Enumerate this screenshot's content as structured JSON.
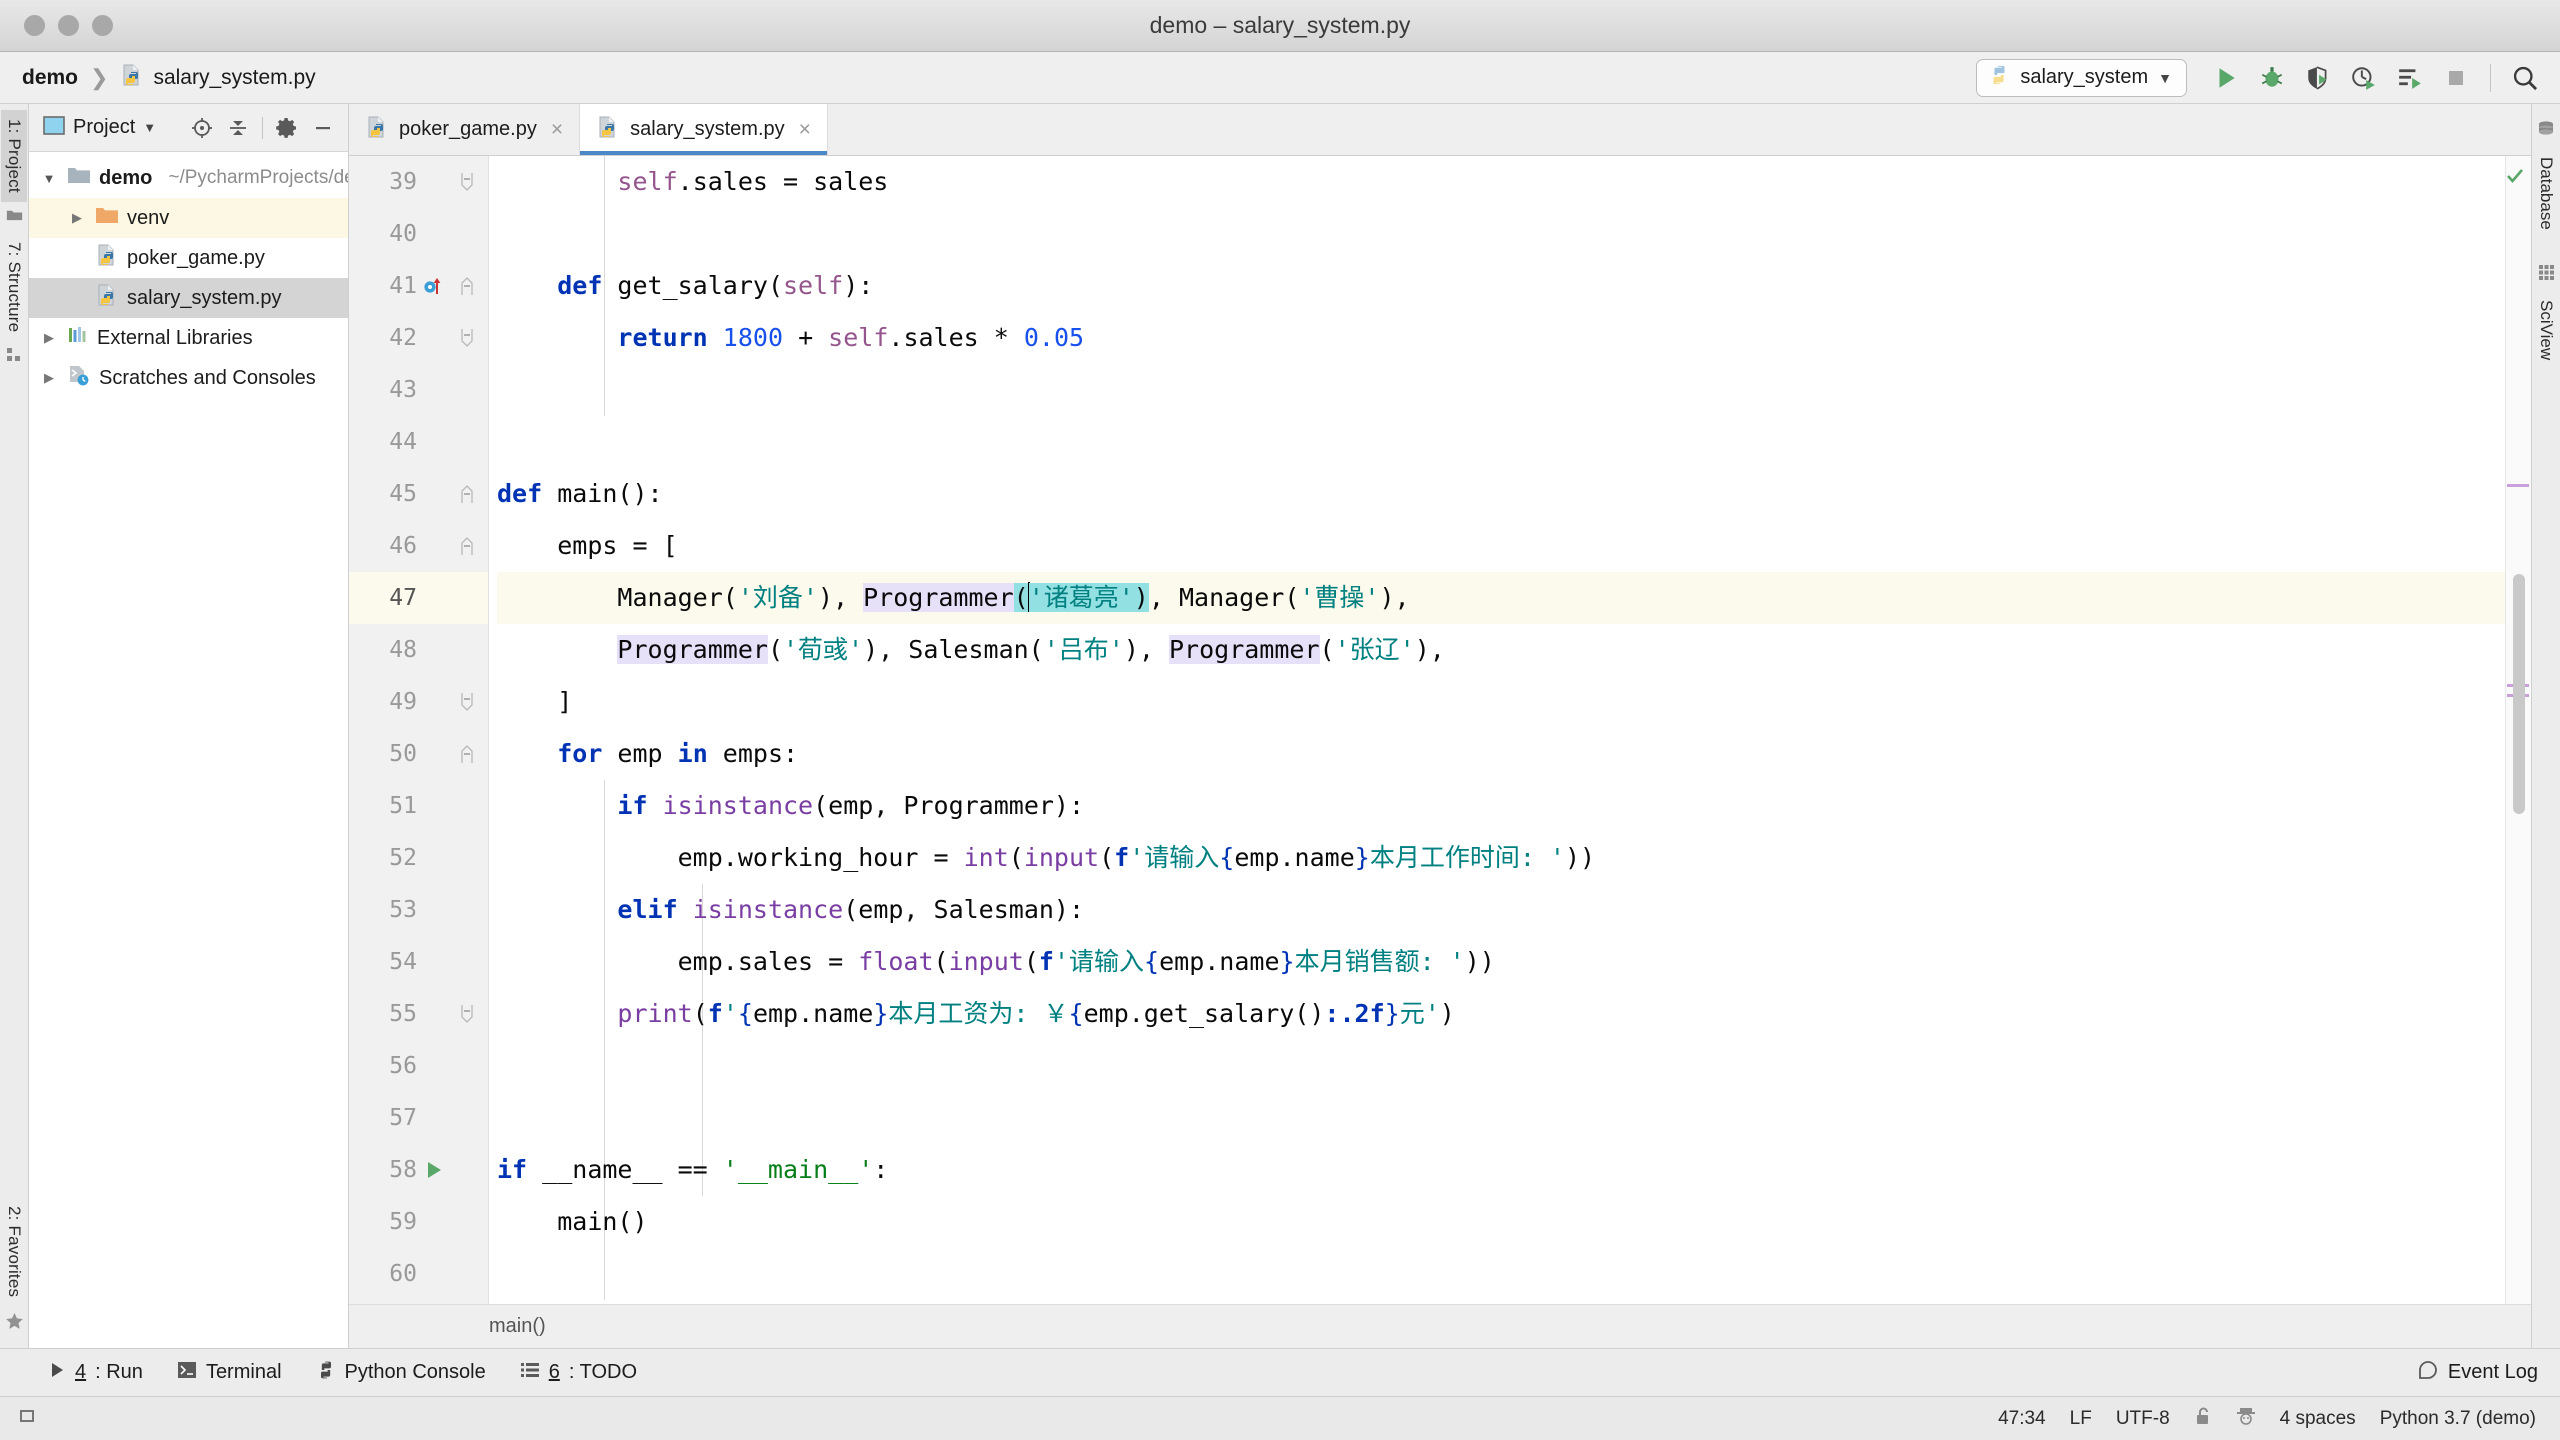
{
  "window": {
    "title": "demo – salary_system.py",
    "traffic_lights": [
      "close-button",
      "minimize-button",
      "zoom-button"
    ]
  },
  "navbar": {
    "breadcrumb": {
      "project": "demo",
      "separator": "❯",
      "file": "salary_system.py"
    },
    "run_config": {
      "label": "salary_system",
      "chevron": "▼"
    },
    "buttons": [
      {
        "name": "run-button",
        "label": "Run"
      },
      {
        "name": "debug-button",
        "label": "Debug"
      },
      {
        "name": "run-with-coverage-button",
        "label": "Run with Coverage"
      },
      {
        "name": "profile-button",
        "label": "Profile"
      },
      {
        "name": "run-tests-button",
        "label": "Run Tests"
      },
      {
        "name": "stop-button",
        "label": "Stop"
      },
      {
        "name": "search-everywhere-button",
        "label": "Search Everywhere"
      }
    ]
  },
  "left_rail": {
    "tabs": [
      {
        "name": "tool-tab-project",
        "label": "1: Project",
        "selected": true
      },
      {
        "name": "tool-tab-structure",
        "label": "7: Structure",
        "selected": false
      },
      {
        "name": "tool-tab-favorites",
        "label": "2: Favorites",
        "selected": false
      }
    ]
  },
  "right_rail": {
    "tabs": [
      {
        "name": "tool-tab-database",
        "label": "Database"
      },
      {
        "name": "tool-tab-sciview",
        "label": "SciView"
      }
    ]
  },
  "project_panel": {
    "title": "Project",
    "title_chevron": "▼",
    "actions": [
      {
        "name": "select-opened-file-button",
        "label": "Select Opened File"
      },
      {
        "name": "collapse-all-button",
        "label": "Collapse All"
      },
      {
        "name": "settings-gear-button",
        "label": "Settings"
      },
      {
        "name": "hide-panel-button",
        "label": "Hide"
      }
    ],
    "tree": [
      {
        "label": "demo",
        "path": "~/PycharmProjects/demo",
        "icon": "folder-icon",
        "arrow": "▼",
        "depth": 0,
        "bold": true,
        "state": "none"
      },
      {
        "label": "venv",
        "path": "",
        "icon": "folder-orange-icon",
        "arrow": "▶",
        "depth": 1,
        "bold": false,
        "state": "highlight"
      },
      {
        "label": "poker_game.py",
        "path": "",
        "icon": "python-file-icon",
        "arrow": "",
        "depth": 1,
        "bold": false,
        "state": "none"
      },
      {
        "label": "salary_system.py",
        "path": "",
        "icon": "python-file-icon",
        "arrow": "",
        "depth": 1,
        "bold": false,
        "state": "selected"
      },
      {
        "label": "External Libraries",
        "path": "",
        "icon": "libraries-icon",
        "arrow": "▶",
        "depth": 0,
        "bold": false,
        "state": "none"
      },
      {
        "label": "Scratches and Consoles",
        "path": "",
        "icon": "scratches-icon",
        "arrow": "▶",
        "depth": 0,
        "bold": false,
        "state": "none"
      }
    ]
  },
  "editor": {
    "tabs": [
      {
        "label": "poker_game.py",
        "icon": "python-file-icon",
        "close": "×",
        "active": false
      },
      {
        "label": "salary_system.py",
        "icon": "python-file-icon",
        "close": "×",
        "active": true
      }
    ],
    "breadcrumb": "main()",
    "first_line_number": 39,
    "lines": [
      {
        "n": 39,
        "fold": "end",
        "mark": ""
      },
      {
        "n": 40,
        "fold": "",
        "mark": ""
      },
      {
        "n": 41,
        "fold": "start",
        "mark": "override-method-icon"
      },
      {
        "n": 42,
        "fold": "end",
        "mark": ""
      },
      {
        "n": 43,
        "fold": "",
        "mark": ""
      },
      {
        "n": 44,
        "fold": "",
        "mark": ""
      },
      {
        "n": 45,
        "fold": "start",
        "mark": ""
      },
      {
        "n": 46,
        "fold": "start",
        "mark": ""
      },
      {
        "n": 47,
        "fold": "",
        "mark": "",
        "current": true
      },
      {
        "n": 48,
        "fold": "",
        "mark": ""
      },
      {
        "n": 49,
        "fold": "end",
        "mark": ""
      },
      {
        "n": 50,
        "fold": "start",
        "mark": ""
      },
      {
        "n": 51,
        "fold": "",
        "mark": ""
      },
      {
        "n": 52,
        "fold": "",
        "mark": ""
      },
      {
        "n": 53,
        "fold": "",
        "mark": ""
      },
      {
        "n": 54,
        "fold": "",
        "mark": ""
      },
      {
        "n": 55,
        "fold": "end",
        "mark": ""
      },
      {
        "n": 56,
        "fold": "",
        "mark": ""
      },
      {
        "n": 57,
        "fold": "",
        "mark": ""
      },
      {
        "n": 58,
        "fold": "",
        "mark": "run-gutter-icon"
      },
      {
        "n": 59,
        "fold": "",
        "mark": ""
      },
      {
        "n": 60,
        "fold": "",
        "mark": ""
      }
    ],
    "source_text": [
      "        self.sales = sales",
      "",
      "    def get_salary(self):",
      "        return 1800 + self.sales * 0.05",
      "",
      "",
      "def main():",
      "    emps = [",
      "        Manager('刘备'), Programmer('诸葛亮'), Manager('曹操'),",
      "        Programmer('荀彧'), Salesman('吕布'), Programmer('张辽'),",
      "    ]",
      "    for emp in emps:",
      "        if isinstance(emp, Programmer):",
      "            emp.working_hour = int(input(f'请输入{emp.name}本月工作时间: '))",
      "        elif isinstance(emp, Salesman):",
      "            emp.sales = float(input(f'请输入{emp.name}本月销售额: '))",
      "        print(f'{emp.name}本月工资为: ￥{emp.get_salary():.2f}元')",
      "",
      "",
      "if __name__ == '__main__':",
      "    main()",
      ""
    ],
    "inspection_status": "ok-check-icon"
  },
  "bottom_toolbar": {
    "items": [
      {
        "name": "tool-window-run",
        "num": "4",
        "label": ": Run",
        "icon": "play-icon"
      },
      {
        "name": "tool-window-terminal",
        "num": "",
        "label": "Terminal",
        "icon": "terminal-icon"
      },
      {
        "name": "tool-window-python-console",
        "num": "",
        "label": "Python Console",
        "icon": "python-icon"
      },
      {
        "name": "tool-window-todo",
        "num": "6",
        "label": ": TODO",
        "icon": "todo-icon"
      }
    ],
    "event_log": {
      "label": "Event Log",
      "icon": "balloon-icon"
    }
  },
  "statusbar": {
    "caret_position": "47:34",
    "line_separator": "LF",
    "encoding": "UTF-8",
    "lock_icon": "unlocked-icon",
    "hat_icon": "hector-icon",
    "indent": "4 spaces",
    "interpreter": "Python 3.7 (demo)"
  },
  "colors": {
    "accent_tab": "#4a88c7",
    "keyword": "#0033b3",
    "string_cjk": "#008080",
    "self": "#94558d",
    "builtin": "#7a3ea3",
    "number": "#1750eb",
    "current_line": "#fcfaec",
    "identifier_highlight": "#e6e0f8",
    "bracket_match": "#93e0e3",
    "selection_tree": "#d4d4d4"
  }
}
